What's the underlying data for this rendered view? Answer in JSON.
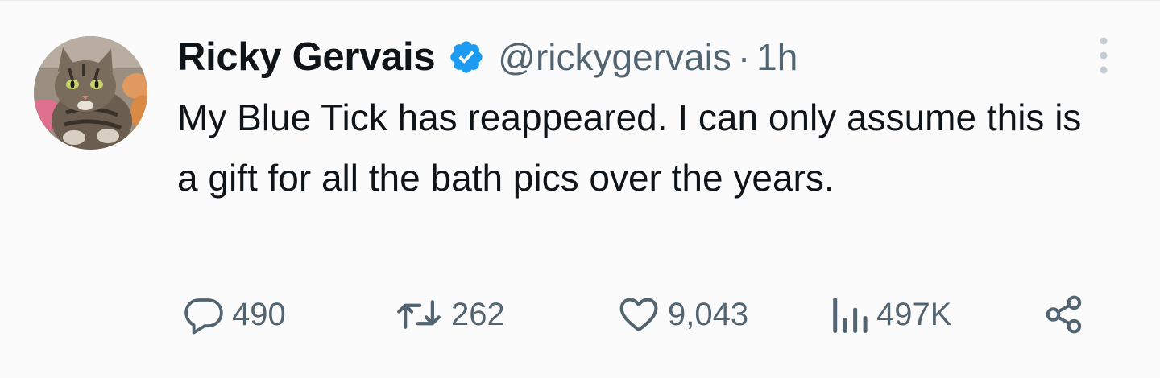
{
  "tweet": {
    "author": {
      "display_name": "Ricky Gervais",
      "handle": "@rickygervais",
      "verified": true,
      "avatar": "tabby-cat-avatar"
    },
    "separator": "·",
    "time": "1h",
    "text": "My Blue Tick has reappeared. I can only assume this is a gift for all the bath pics over the years.",
    "stats": {
      "replies": "490",
      "retweets": "262",
      "likes": "9,043",
      "views": "497K"
    }
  },
  "icons": {
    "verified": "verified-badge-icon",
    "more": "more-vertical-icon",
    "reply": "reply-icon",
    "retweet": "retweet-icon",
    "like": "heart-icon",
    "views": "views-chart-icon",
    "share": "share-icon"
  },
  "colors": {
    "verified_blue": "#1d9bf0",
    "text_primary": "#0f1419",
    "text_secondary": "#536471",
    "background": "#fbfbfc"
  }
}
